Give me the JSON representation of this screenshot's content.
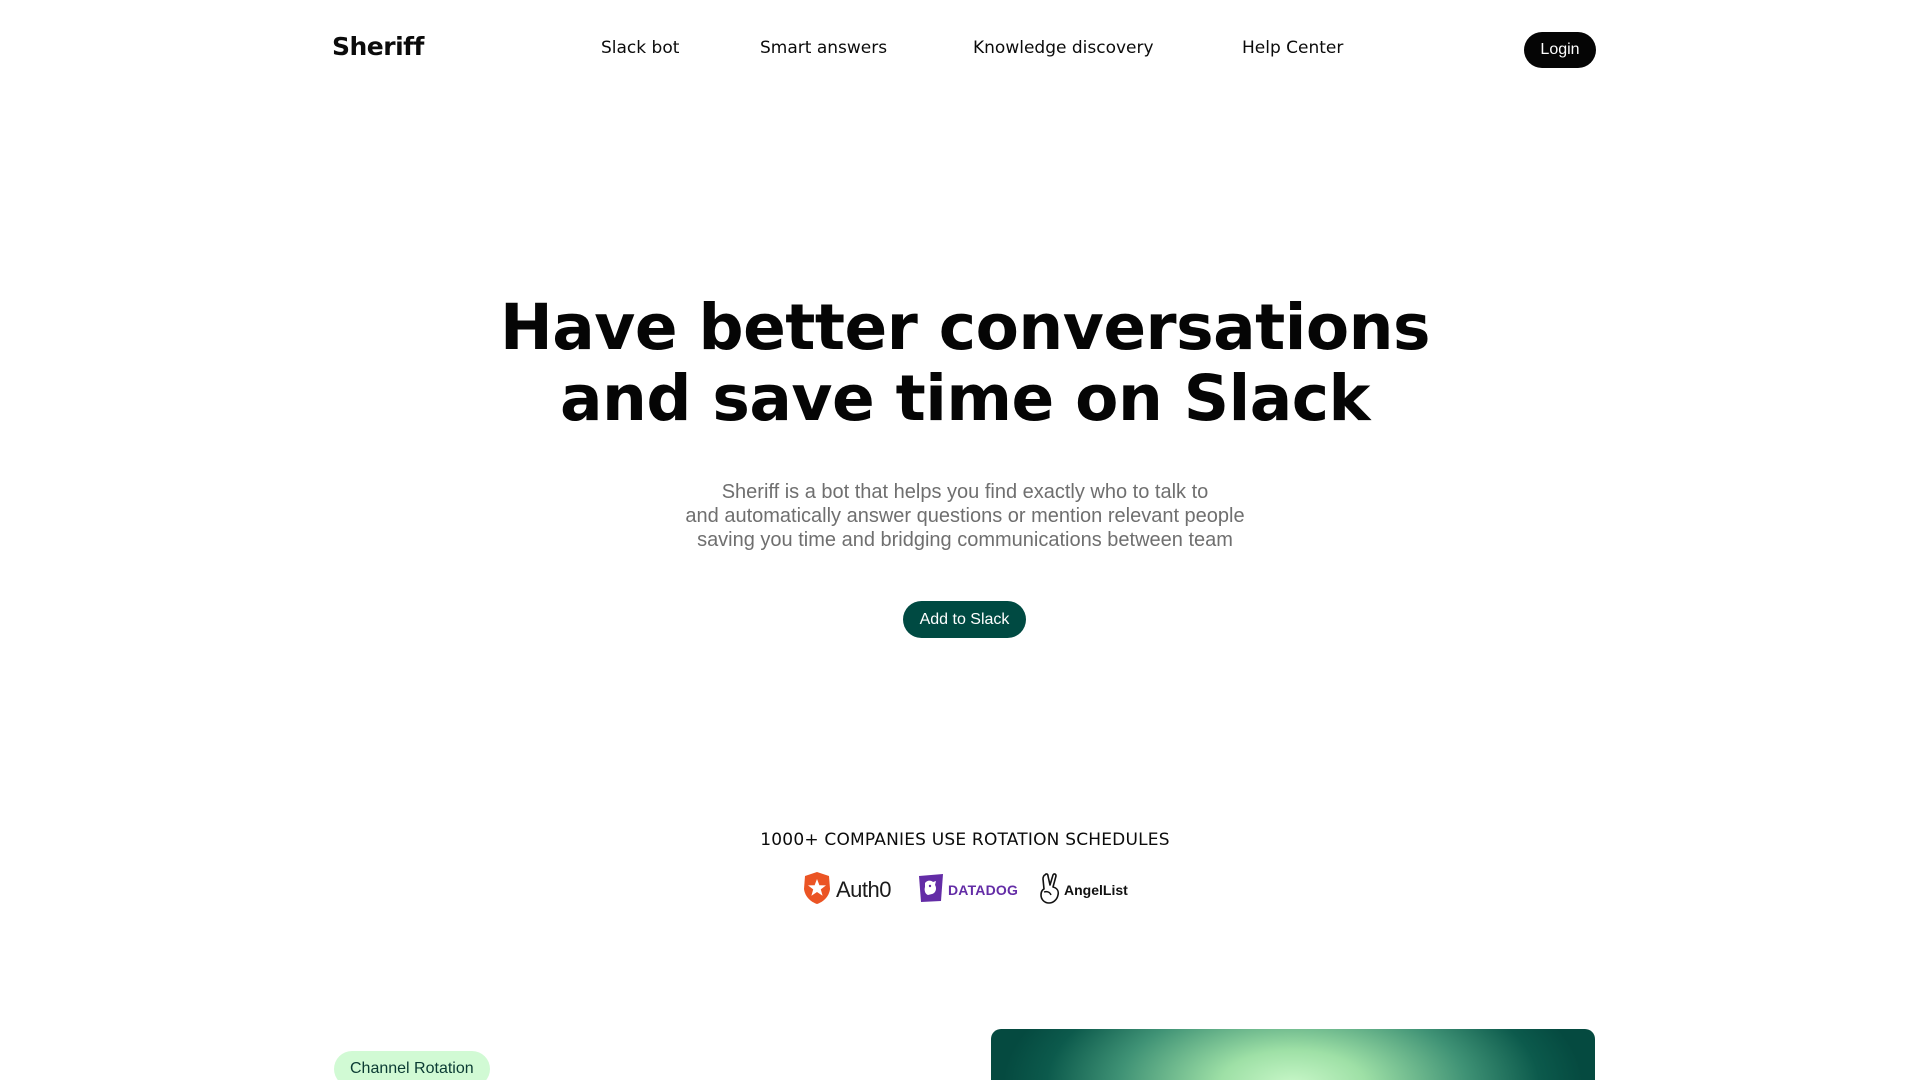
{
  "header": {
    "logo": "Sheriff",
    "nav": [
      "Slack bot",
      "Smart answers",
      "Knowledge discovery",
      "Help Center"
    ],
    "login_label": "Login"
  },
  "hero": {
    "title_line1": "Have better conversations",
    "title_line2": "and save time on Slack",
    "subtitle_line1": "Sheriff is a bot that helps you find exactly who to talk to",
    "subtitle_line2": "and automatically answer questions or mention relevant people",
    "subtitle_line3": "saving you time and bridging communications between team",
    "cta_label": "Add to Slack"
  },
  "companies": {
    "title": "1000+ COMPANIES USE ROTATION SCHEDULES",
    "logos": [
      {
        "name": "Auth0",
        "icon": "auth0-star-shield-icon",
        "color": "#eb5424"
      },
      {
        "name": "DATADOG",
        "icon": "datadog-dog-icon",
        "color": "#632ca6"
      },
      {
        "name": "AngelList",
        "icon": "angellist-peace-hand-icon",
        "color": "#111111"
      }
    ]
  },
  "feature": {
    "badge_label": "Channel Rotation"
  },
  "colors": {
    "primary_dark": "#004a42",
    "badge_bg": "#d1fad4",
    "login_bg": "#050505"
  }
}
